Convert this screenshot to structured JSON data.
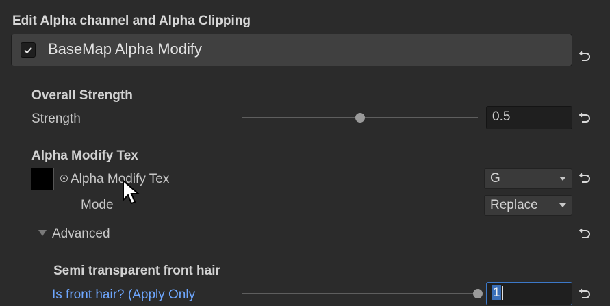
{
  "section": {
    "title": "Edit Alpha channel and Alpha Clipping"
  },
  "header": {
    "checkbox_checked": true,
    "label": "BaseMap Alpha Modify"
  },
  "overall_strength": {
    "group_title": "Overall Strength",
    "label": "Strength",
    "value": "0.5",
    "slider_fraction": 0.5
  },
  "alpha_modify_tex": {
    "group_title": "Alpha Modify Tex",
    "texture_label": "Alpha Modify Tex",
    "channel_selected": "G",
    "mode_label": "Mode",
    "mode_selected": "Replace"
  },
  "advanced": {
    "label": "Advanced",
    "expanded": true
  },
  "semi_transparent": {
    "group_title": "Semi transparent front hair",
    "label": "Is front hair? (Apply Only",
    "value": "1",
    "slider_fraction": 1.0
  },
  "icons": {
    "reset": "reset-arrow-icon",
    "check": "checkmark-icon",
    "object_picker": "object-picker-icon",
    "foldout": "foldout-arrow-icon",
    "cursor": "mouse-pointer-icon"
  },
  "colors": {
    "background": "#2b2b2b",
    "link_blue": "#6ea7ff",
    "focus_border": "#3c78c8",
    "selection": "#3a6fb8"
  }
}
